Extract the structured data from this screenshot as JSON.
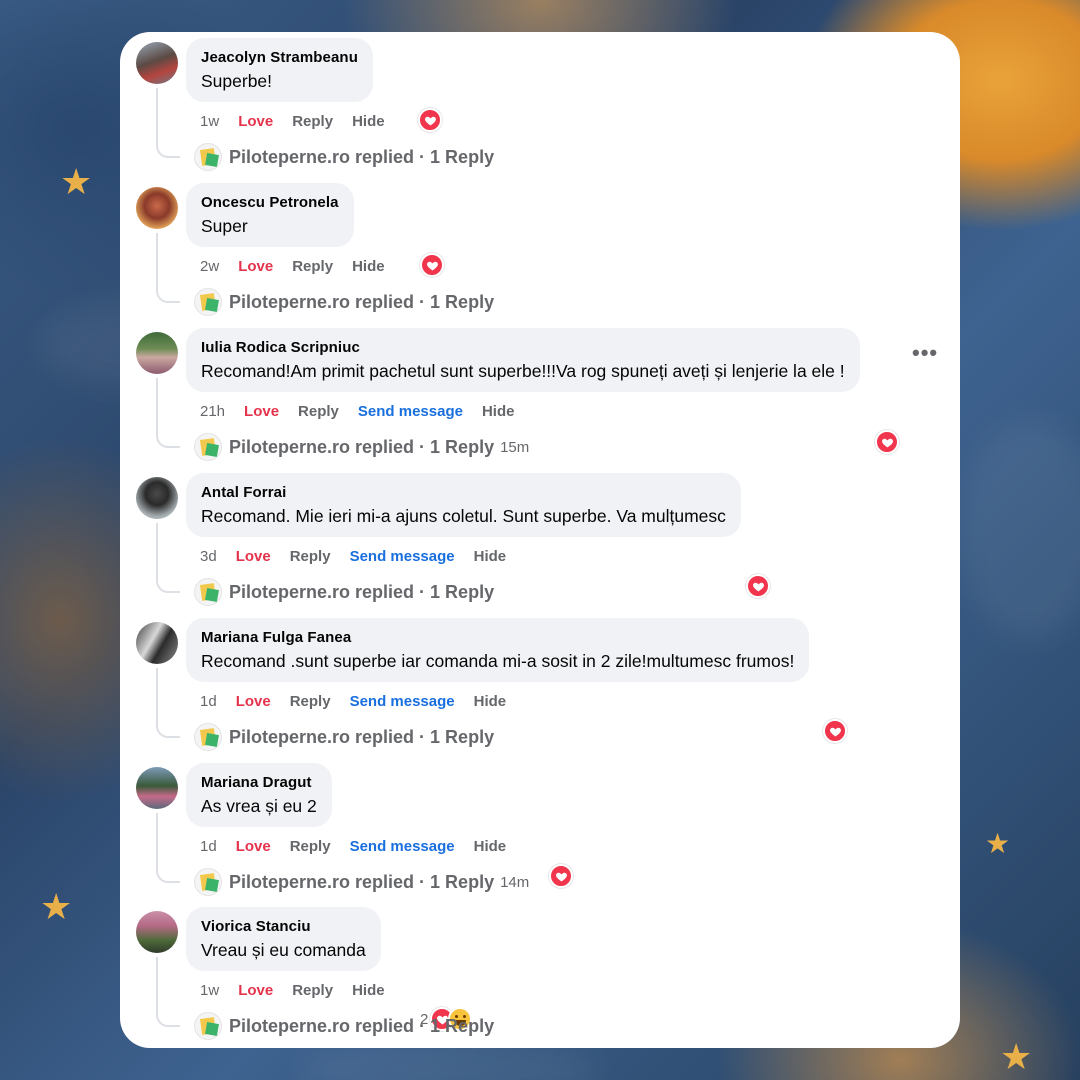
{
  "page": {
    "replied_label_suffix": "replied · 1 Reply"
  },
  "comments": [
    {
      "author": "Jeacolyn Strambeanu",
      "text": "Superbe!",
      "time": "1w",
      "actions": {
        "love": "Love",
        "reply": "Reply",
        "hide": "Hide"
      },
      "reaction": "heart",
      "replied": {
        "page": "Piloteperne.ro",
        "label": "replied · 1 Reply",
        "time": ""
      }
    },
    {
      "author": "Oncescu Petronela",
      "text": "Super",
      "time": "2w",
      "actions": {
        "love": "Love",
        "reply": "Reply",
        "hide": "Hide"
      },
      "reaction": "heart",
      "replied": {
        "page": "Piloteperne.ro",
        "label": "replied · 1 Reply",
        "time": ""
      }
    },
    {
      "author": "Iulia Rodica Scripniuc",
      "text": "Recomand!Am primit pachetul sunt superbe!!!Va rog spuneți aveți și lenjerie la ele !",
      "time": "21h",
      "actions": {
        "love": "Love",
        "reply": "Reply",
        "send": "Send message",
        "hide": "Hide"
      },
      "reaction": "heart",
      "more": "•••",
      "replied": {
        "page": "Piloteperne.ro",
        "label": "replied · 1 Reply",
        "time": "15m"
      }
    },
    {
      "author": "Antal Forrai",
      "text": "Recomand. Mie ieri mi-a ajuns coletul. Sunt superbe. Va mulțumesc",
      "time": "3d",
      "actions": {
        "love": "Love",
        "reply": "Reply",
        "send": "Send message",
        "hide": "Hide"
      },
      "reaction": "heart",
      "replied": {
        "page": "Piloteperne.ro",
        "label": "replied · 1 Reply",
        "time": ""
      }
    },
    {
      "author": "Mariana Fulga Fanea",
      "text": "Recomand .sunt superbe iar comanda mi-a sosit in 2 zile!multumesc frumos!",
      "time": "1d",
      "actions": {
        "love": "Love",
        "reply": "Reply",
        "send": "Send message",
        "hide": "Hide"
      },
      "reaction": "heart",
      "replied": {
        "page": "Piloteperne.ro",
        "label": "replied · 1 Reply",
        "time": ""
      }
    },
    {
      "author": "Mariana Dragut",
      "text": "As vrea și eu 2",
      "time": "1d",
      "actions": {
        "love": "Love",
        "reply": "Reply",
        "send": "Send message",
        "hide": "Hide"
      },
      "reaction": "heart",
      "replied": {
        "page": "Piloteperne.ro",
        "label": "replied · 1 Reply",
        "time": "14m"
      }
    },
    {
      "author": "Viorica Stanciu",
      "text": "Vreau și eu comanda",
      "time": "1w",
      "actions": {
        "love": "Love",
        "reply": "Reply",
        "hide": "Hide"
      },
      "reaction": "heart+haha",
      "reaction_count": "2",
      "replied": {
        "page": "Piloteperne.ro",
        "label": "replied · 1 Reply",
        "time": ""
      }
    }
  ],
  "colors": {
    "love": "#e4344c",
    "send_message": "#1a6fde",
    "muted": "#65676b",
    "bubble": "#f0f2f5",
    "heart_reaction": "#f0354d"
  },
  "icons": [
    "heart-reaction-icon",
    "haha-reaction-icon",
    "more-options-icon",
    "page-avatar-icon"
  ]
}
